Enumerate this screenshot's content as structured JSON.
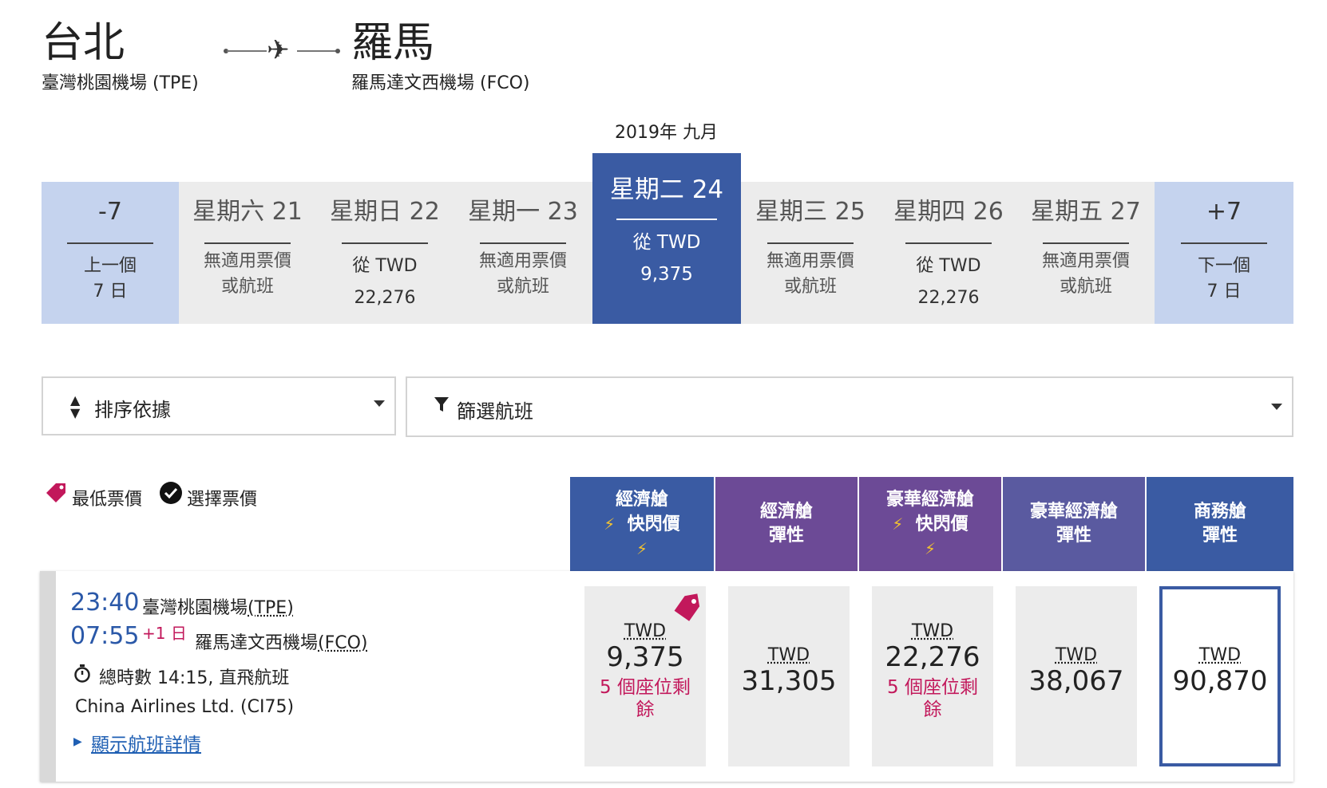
{
  "route": {
    "origin_city": "台北",
    "origin_airport": "臺灣桃園機場 (TPE)",
    "dest_city": "羅馬",
    "dest_airport": "羅馬達文西機場 (FCO)",
    "arrow_icon": "airplane-icon"
  },
  "month_label": "2019年 九月",
  "dates": [
    {
      "day": "-7",
      "line1": "上一個",
      "line2": "7 日"
    },
    {
      "day": "星期六 21",
      "line1": "無適用票價",
      "line2": "或航班"
    },
    {
      "day": "星期日 22",
      "line1": "從 TWD",
      "line2": "22,276"
    },
    {
      "day": "星期一 23",
      "line1": "無適用票價",
      "line2": "或航班"
    },
    {
      "day": "星期二 24",
      "line1": "從 TWD",
      "line2": "9,375"
    },
    {
      "day": "星期三 25",
      "line1": "無適用票價",
      "line2": "或航班"
    },
    {
      "day": "星期四 26",
      "line1": "從 TWD",
      "line2": "22,276"
    },
    {
      "day": "星期五 27",
      "line1": "無適用票價",
      "line2": "或航班"
    },
    {
      "day": "+7",
      "line1": "下一個",
      "line2": "7 日"
    }
  ],
  "controls": {
    "sort_label": "排序依據",
    "filter_label": "篩選航班"
  },
  "legend": {
    "lowest": "最低票價",
    "selected": "選擇票價"
  },
  "cabins": [
    {
      "line1": "經濟艙",
      "line2": "快閃價",
      "flash": true,
      "color": "#3a5ba3"
    },
    {
      "line1": "經濟艙",
      "line2": "彈性",
      "flash": false,
      "color": "#6c4a96"
    },
    {
      "line1": "豪華經濟艙",
      "line2": "快閃價",
      "flash": true,
      "color": "#6c4a96"
    },
    {
      "line1": "豪華經濟艙",
      "line2": "彈性",
      "flash": false,
      "color": "#5a5aa0"
    },
    {
      "line1": "商務艙",
      "line2": "彈性",
      "flash": false,
      "color": "#3a5ba3"
    }
  ],
  "flight": {
    "depart_time": "23:40",
    "depart_airport": "臺灣桃園機場",
    "depart_code": "(TPE)",
    "arrive_time": "07:55",
    "day_offset": "+1 日",
    "arrive_airport": "羅馬達文西機場",
    "arrive_code": "(FCO)",
    "duration": "總時數 14:15, 直飛航班",
    "airline": "China Airlines Ltd. (CI75)",
    "details_link": "顯示航班詳情"
  },
  "fares": [
    {
      "currency": "TWD",
      "amount": "9,375",
      "seats": "5 個座位剩",
      "seats2": "餘"
    },
    {
      "currency": "TWD",
      "amount": "31,305",
      "seats": "",
      "seats2": ""
    },
    {
      "currency": "TWD",
      "amount": "22,276",
      "seats": "5 個座位剩",
      "seats2": "餘"
    },
    {
      "currency": "TWD",
      "amount": "38,067",
      "seats": "",
      "seats2": ""
    },
    {
      "currency": "TWD",
      "amount": "90,870",
      "seats": "",
      "seats2": ""
    }
  ],
  "colors": {
    "primary": "#3a5ba3",
    "nav_cell": "#c5d3ee",
    "purple": "#6c4a96",
    "accent_red": "#c2185b"
  }
}
